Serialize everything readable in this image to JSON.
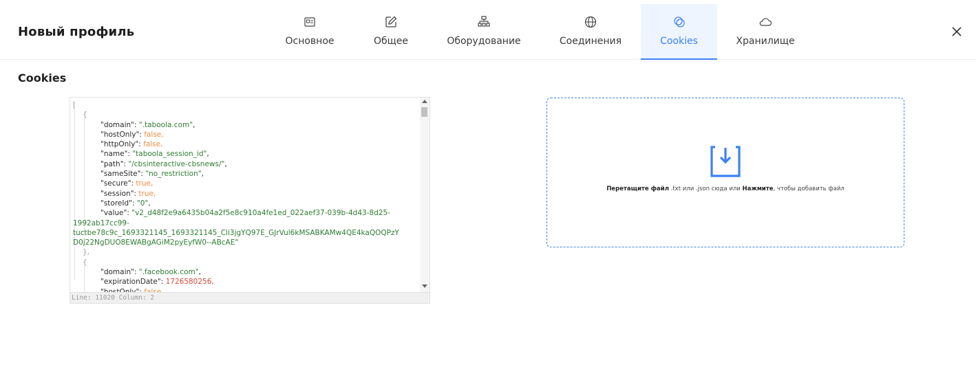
{
  "header": {
    "title": "Новый профиль",
    "tabs": [
      {
        "label": "Основное",
        "icon": "id-card-icon"
      },
      {
        "label": "Общее",
        "icon": "edit-icon"
      },
      {
        "label": "Оборудование",
        "icon": "hierarchy-icon"
      },
      {
        "label": "Соединения",
        "icon": "globe-icon"
      },
      {
        "label": "Cookies",
        "icon": "cookie-icon",
        "active": true
      },
      {
        "label": "Хранилище",
        "icon": "cloud-icon"
      }
    ],
    "accent_color": "#3b82f6"
  },
  "section": {
    "title": "Cookies"
  },
  "editor": {
    "lines": [
      {
        "t": "["
      },
      {
        "t": "{"
      },
      {
        "key": "\"domain\"",
        "val": "\".taboola.com\"",
        "type": "s"
      },
      {
        "key": "\"hostOnly\"",
        "val": "false,",
        "type": "b"
      },
      {
        "key": "\"httpOnly\"",
        "val": "false,",
        "type": "b"
      },
      {
        "key": "\"name\"",
        "val": "\"taboola_session_id\"",
        "type": "s"
      },
      {
        "key": "\"path\"",
        "val": "\"/cbsinteractive-cbsnews/\"",
        "type": "s"
      },
      {
        "key": "\"sameSite\"",
        "val": "\"no_restriction\"",
        "type": "s"
      },
      {
        "key": "\"secure\"",
        "val": "true,",
        "type": "b"
      },
      {
        "key": "\"session\"",
        "val": "true,",
        "type": "b"
      },
      {
        "key": "\"storeId\"",
        "val": "\"0\"",
        "type": "s"
      },
      {
        "key": "\"value\"",
        "val": "\"v2_d48f2e9a6435b04a2f5e8c910a4fe1ed_022aef37-039b-4d43-8d25-",
        "type": "s"
      },
      {
        "wrap": "1992ab17cc99-"
      },
      {
        "wrap": "tuctbe78c9c_1693321145_1693321145_Cli3jgYQ97E_GJrVul6kMSABKAMw4QE4kaQOQPzY"
      },
      {
        "wrap": "D0j22NgDUO8EWABgAGiM2pyEyfW0--ABcAE\""
      },
      {
        "t": "},"
      },
      {
        "t": "{"
      },
      {
        "key": "\"domain\"",
        "val": "\".facebook.com\"",
        "type": "s"
      },
      {
        "key": "\"expirationDate\"",
        "val": "1726580256,",
        "type": "n"
      },
      {
        "key": "\"hostOnly\"",
        "val": "false,",
        "type": "b"
      }
    ],
    "status": "Line: 11020  Column: 2"
  },
  "dropzone": {
    "bold1": "Перетащите файл",
    "mid": " .txt или .json сюда или ",
    "bold2": "Нажмите",
    "tail": ", чтобы добавить файл",
    "icon": "download-tray-icon"
  }
}
